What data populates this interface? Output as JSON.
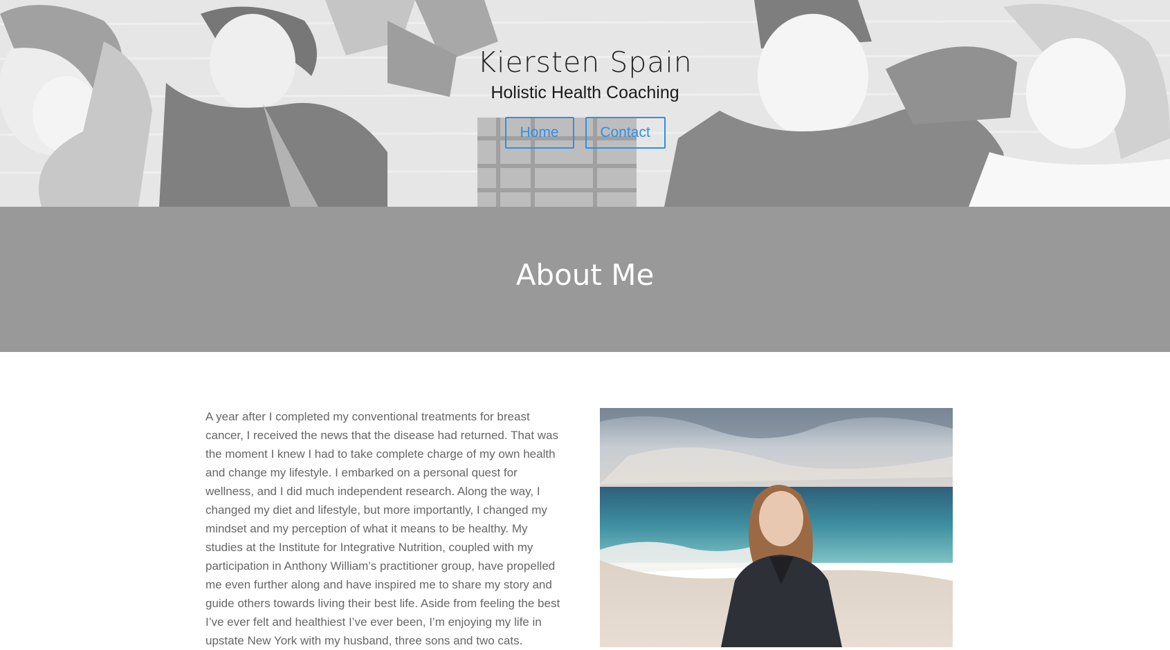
{
  "header": {
    "site_title": "Kiersten Spain",
    "tagline": "Holistic Health Coaching",
    "nav": [
      {
        "label": "Home"
      },
      {
        "label": "Contact"
      }
    ]
  },
  "about": {
    "title": "About Me",
    "bio": "A year after I completed my conventional treatments for breast cancer, I received the news that the disease had returned. That was the moment I knew I had to take complete charge of my own health and change my lifestyle. I embarked on a personal quest for wellness, and I did much independent research. Along the way, I changed my diet and lifestyle, but more importantly, I changed my mindset and my perception of what it means to be healthy. My studies at the Institute for Integrative Nutrition, coupled with my participation in Anthony William’s practitioner group, have propelled me even further along and have inspired me to share my story and guide others towards living their best life. Aside from feeling the best I’ve ever felt and healthiest I’ve ever been, I’m enjoying my life in upstate New York with my husband, three sons and two cats."
  },
  "colors": {
    "accent": "#2f8fe6",
    "banner": "#999999",
    "body_text": "#666666"
  }
}
